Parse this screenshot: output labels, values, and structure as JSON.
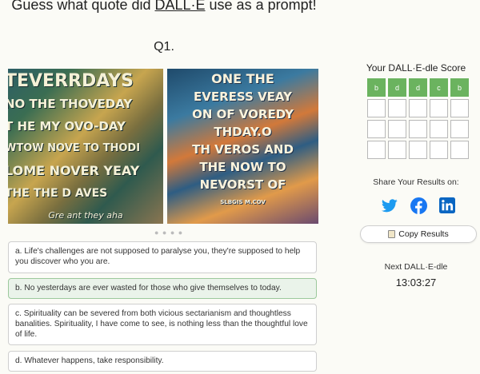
{
  "header": {
    "title_prefix": "Guess what quote did ",
    "title_brand": "DALL·E",
    "title_suffix": " use as a prompt!",
    "question_number": "Q1."
  },
  "images": [
    {
      "caption_lines": [
        "TEVERRDAYS",
        "NO THE THOVEDAY",
        "T HE MY OVO-DAY",
        "WTOW NOVE TO THODI",
        "LOME NOVER YEAY",
        "THE THE D AVES",
        "Gre ant they aha"
      ]
    },
    {
      "caption_lines": [
        "ONE THE",
        "EVERESS VEAY",
        "ON OF VOREDY",
        "THDAY.O",
        "TH VEROS AND",
        "THE NOW TO",
        "NEVORST OF",
        "SLBGIS M.COV"
      ]
    }
  ],
  "carousel_dots": "● ● ● ●",
  "options": [
    {
      "label": "a.",
      "text": "Life's challenges are not supposed to paralyse you, they're supposed to help you discover who you are.",
      "selected": false
    },
    {
      "label": "b.",
      "text": "No yesterdays are ever wasted for those who give themselves to today.",
      "selected": true
    },
    {
      "label": "c.",
      "text": "Spirituality can be severed from both vicious sectarianism and thoughtless banalities. Spirituality, I have come to see, is nothing less than the thoughtful love of life.",
      "selected": false
    },
    {
      "label": "d.",
      "text": "Whatever happens, take responsibility.",
      "selected": false
    }
  ],
  "score": {
    "title": "Your DALL·E-dle Score",
    "rows": [
      [
        "b",
        "d",
        "d",
        "c",
        "b"
      ],
      [
        "",
        "",
        "",
        "",
        ""
      ],
      [
        "",
        "",
        "",
        "",
        ""
      ],
      [
        "",
        "",
        "",
        "",
        ""
      ]
    ],
    "correct_color": "#6bb35f"
  },
  "share": {
    "label": "Share Your Results on:",
    "icons": [
      "twitter-icon",
      "facebook-icon",
      "linkedin-icon"
    ],
    "copy_label": "Copy Results"
  },
  "next": {
    "label": "Next DALL·E-dle",
    "countdown": "13:03:27"
  }
}
